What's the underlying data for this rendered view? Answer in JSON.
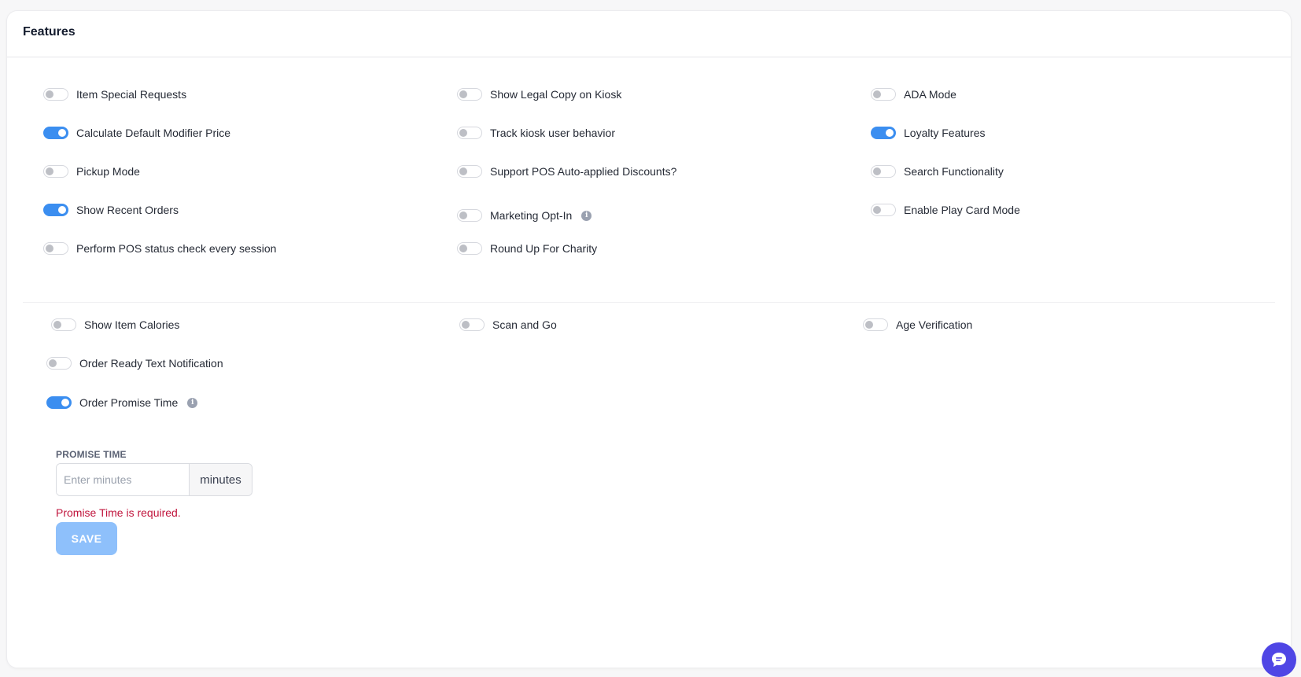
{
  "card": {
    "title": "Features"
  },
  "features": {
    "item_special_requests": {
      "label": "Item Special Requests",
      "on": false
    },
    "show_legal_copy": {
      "label": "Show Legal Copy on Kiosk",
      "on": false
    },
    "ada_mode": {
      "label": "ADA Mode",
      "on": false
    },
    "calc_default_modifier": {
      "label": "Calculate Default Modifier Price",
      "on": true
    },
    "track_kiosk_behavior": {
      "label": "Track kiosk user behavior",
      "on": false
    },
    "loyalty_features": {
      "label": "Loyalty Features",
      "on": true
    },
    "pickup_mode": {
      "label": "Pickup Mode",
      "on": false
    },
    "support_pos_discounts": {
      "label": "Support POS Auto-applied Discounts?",
      "on": false
    },
    "search_functionality": {
      "label": "Search Functionality",
      "on": false
    },
    "show_recent_orders": {
      "label": "Show Recent Orders",
      "on": true
    },
    "marketing_opt_in": {
      "label": "Marketing Opt-In",
      "on": false
    },
    "enable_play_card": {
      "label": "Enable Play Card Mode",
      "on": false
    },
    "perform_pos_check": {
      "label": "Perform POS status check every session",
      "on": false
    },
    "round_up_charity": {
      "label": "Round Up For Charity",
      "on": false
    },
    "show_item_calories": {
      "label": "Show Item Calories",
      "on": false
    },
    "scan_and_go": {
      "label": "Scan and Go",
      "on": false
    },
    "age_verification": {
      "label": "Age Verification",
      "on": false
    },
    "order_ready_text": {
      "label": "Order Ready Text Notification",
      "on": false
    },
    "order_promise_time": {
      "label": "Order Promise Time",
      "on": true
    }
  },
  "info_icon_glyph": "i",
  "promise_time": {
    "label": "PROMISE TIME",
    "placeholder": "Enter minutes",
    "value": "",
    "suffix": "minutes",
    "error": "Promise Time is required."
  },
  "save_label": "SAVE",
  "colors": {
    "toggle_on": "#3b8ef0",
    "error": "#c0143c",
    "save_button": "#8ec0fb",
    "chat_widget": "#4f46e5"
  }
}
